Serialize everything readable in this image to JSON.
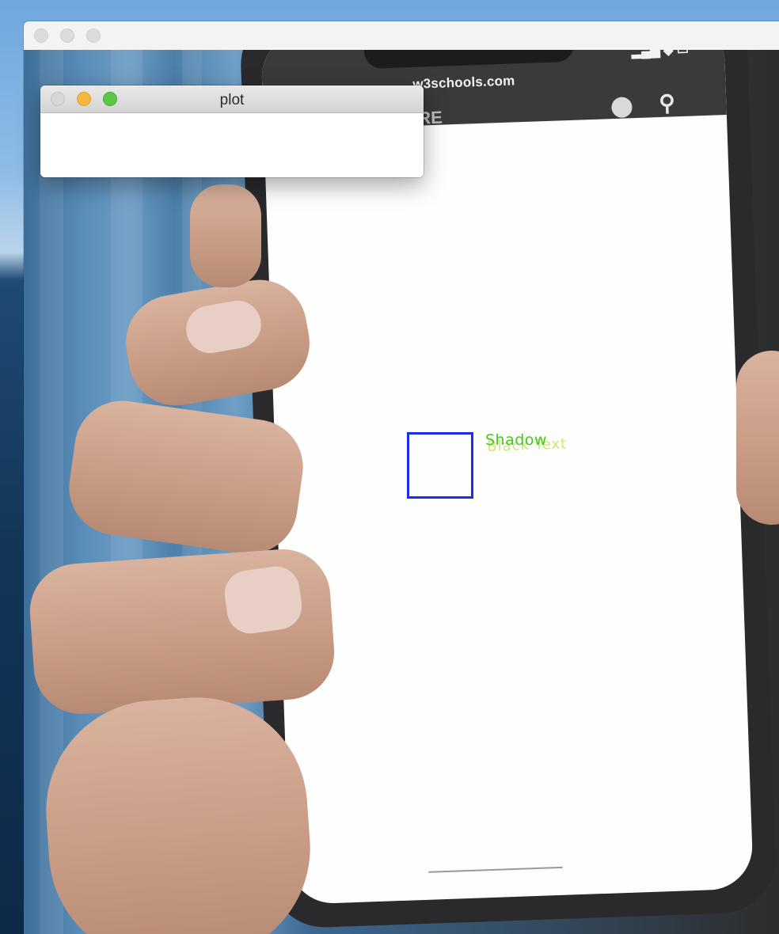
{
  "main_window": {
    "title": ""
  },
  "plot_window": {
    "title": "plot"
  },
  "phone": {
    "url": "w3schools.com",
    "menu_label": "MORE",
    "page_text": "Black Text"
  },
  "detection": {
    "label": "Shadow",
    "box_color": "#1d2fdc",
    "label_color": "#45c91e"
  },
  "colors": {
    "close_button": "#d7d7d7",
    "minimize_button": "#f4b83c",
    "maximize_button": "#5bc747"
  }
}
